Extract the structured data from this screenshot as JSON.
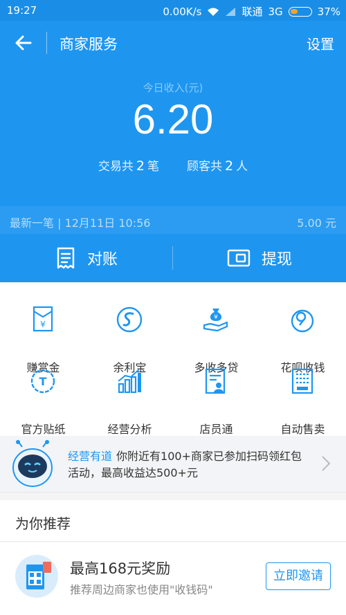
{
  "status_bar": {
    "time": "19:27",
    "speed": "0.00K/s",
    "carrier": "联通",
    "network": "3G",
    "battery": "37%"
  },
  "app_bar": {
    "title": "商家服务",
    "settings_label": "设置",
    "back_icon": "arrow-left-icon"
  },
  "summary": {
    "label": "今日收入(元)",
    "amount": "6.20",
    "transactions_prefix": "交易共",
    "transactions_count": "2",
    "transactions_suffix": "笔",
    "customers_prefix": "顾客共",
    "customers_count": "2",
    "customers_suffix": "人"
  },
  "latest": {
    "label": "最新一笔 | 12月11日 10:56",
    "amount": "5.00 元"
  },
  "actions": {
    "reconcile_label": "对账",
    "withdraw_label": "提现"
  },
  "services": [
    {
      "label": "赚赏金",
      "icon": "red-envelope-icon"
    },
    {
      "label": "余利宝",
      "icon": "yulibao-icon"
    },
    {
      "label": "多收多贷",
      "icon": "money-bag-hand-icon"
    },
    {
      "label": "花呗收钱",
      "icon": "huabei-icon"
    },
    {
      "label": "官方贴纸",
      "icon": "sticker-badge-icon"
    },
    {
      "label": "经营分析",
      "icon": "bar-chart-icon"
    },
    {
      "label": "店员通",
      "icon": "staff-card-icon"
    },
    {
      "label": "自动售卖",
      "icon": "vending-machine-icon"
    }
  ],
  "notice": {
    "highlight": "经营有道",
    "text": "你附近有100+商家已参加扫码领红包活动，最高收益达500+元"
  },
  "recommend": {
    "heading": "为你推荐",
    "item_title": "最高168元奖励",
    "item_subtitle": "推荐周边商家也使用\"收钱码\"",
    "invite_label": "立即邀请"
  },
  "colors": {
    "primary": "#1e96f0",
    "status_bar": "#1a8ee6",
    "battery": "#f0a32b"
  }
}
